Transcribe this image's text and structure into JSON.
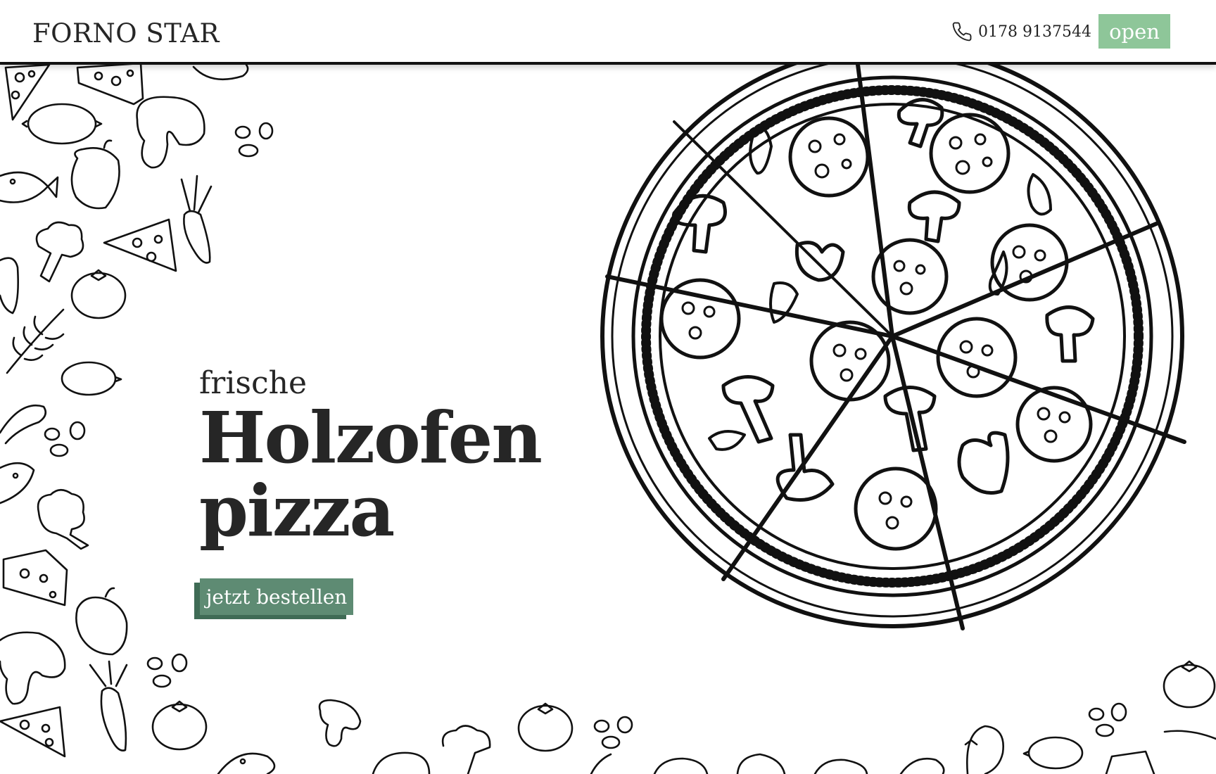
{
  "header": {
    "brand": "FORNO STAR",
    "phone": "0178 9137544",
    "open_label": "open",
    "open_color": "#8ec699"
  },
  "hero": {
    "pre_title": "frische",
    "title_line1": "Holzofen",
    "title_line2": "pizza",
    "cta_label": "jetzt bestellen",
    "cta_color": "#5e8b73"
  },
  "icons": {
    "phone": "phone-icon",
    "illustration": "pizza-illustration",
    "background": "food-doodles"
  }
}
